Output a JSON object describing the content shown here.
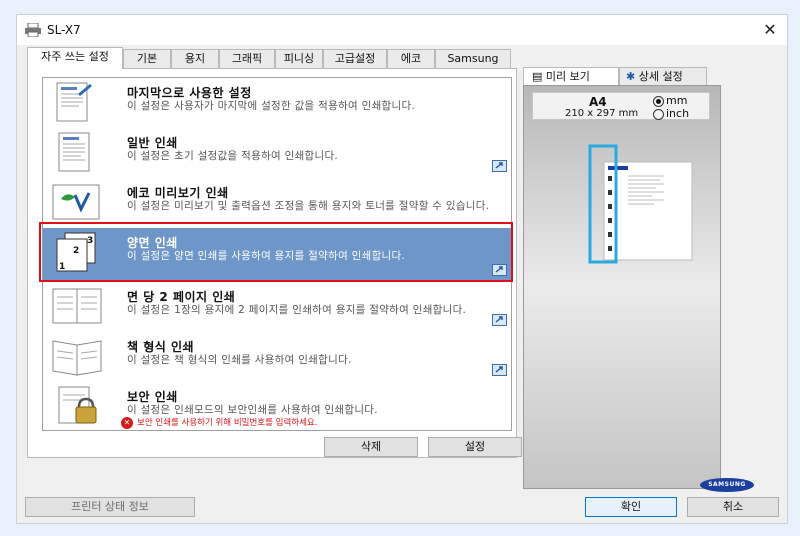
{
  "window": {
    "title": "SL-X7",
    "close_icon": "close-icon"
  },
  "tabs": [
    {
      "label": "자주 쓰는 설정"
    },
    {
      "label": "기본"
    },
    {
      "label": "용지"
    },
    {
      "label": "그래픽"
    },
    {
      "label": "피니싱"
    },
    {
      "label": "고급설정"
    },
    {
      "label": "에코"
    },
    {
      "label": "Samsung"
    }
  ],
  "favorites": [
    {
      "title": "마지막으로 사용한 설정",
      "description": "이 설정은 사용자가 마지막에 설정한 값을 적용하여 인쇄합니다.",
      "icon": "last-used-icon"
    },
    {
      "title": "일반 인쇄",
      "description": "이 설정은 초기 설정값을 적용하여 인쇄합니다.",
      "icon": "normal-print-icon"
    },
    {
      "title": "에코 미리보기 인쇄",
      "description": "이 설정은 미리보기 및 출력옵션 조정을 통해 용지와 토너를 절약할 수 있습니다.",
      "icon": "eco-print-icon"
    },
    {
      "title": "양면 인쇄",
      "description": "이 설정은 양면 인쇄를 사용하여 용지를 절약하여 인쇄합니다.",
      "icon": "duplex-print-icon"
    },
    {
      "title": "면 당 2 페이지 인쇄",
      "description": "이 설정은 1장의 용지에 2 페이지를 인쇄하여 용지를 절약하여 인쇄합니다.",
      "icon": "two-up-print-icon"
    },
    {
      "title": "책 형식 인쇄",
      "description": "이 설정은 책 형식의 인쇄를 사용하여 인쇄합니다.",
      "icon": "booklet-print-icon"
    },
    {
      "title": "보안 인쇄",
      "description": "이 설정은 인쇄모드의 보안인쇄를 사용하여 인쇄합니다.",
      "warning": "보안 인쇄를 사용하기 위해 비밀번호를 입력하세요.",
      "icon": "secure-print-icon"
    }
  ],
  "list_buttons": {
    "delete": "삭제",
    "settings": "설정"
  },
  "preview": {
    "tabs": [
      {
        "label": "미리 보기"
      },
      {
        "label": "상세 설정"
      }
    ],
    "paper_size": "A4",
    "paper_dims": "210 x 297 mm",
    "unit_options": [
      "mm",
      "inch"
    ],
    "unit_selected": "mm",
    "brand_logo": "SAMSUNG"
  },
  "footer": {
    "printer_status": "프린터 상태 정보",
    "ok": "확인",
    "cancel": "취소"
  },
  "colors": {
    "selected_row": "#6f96c9",
    "highlight_frame": "#e0101b",
    "preview_binding": "#29a9e0"
  }
}
